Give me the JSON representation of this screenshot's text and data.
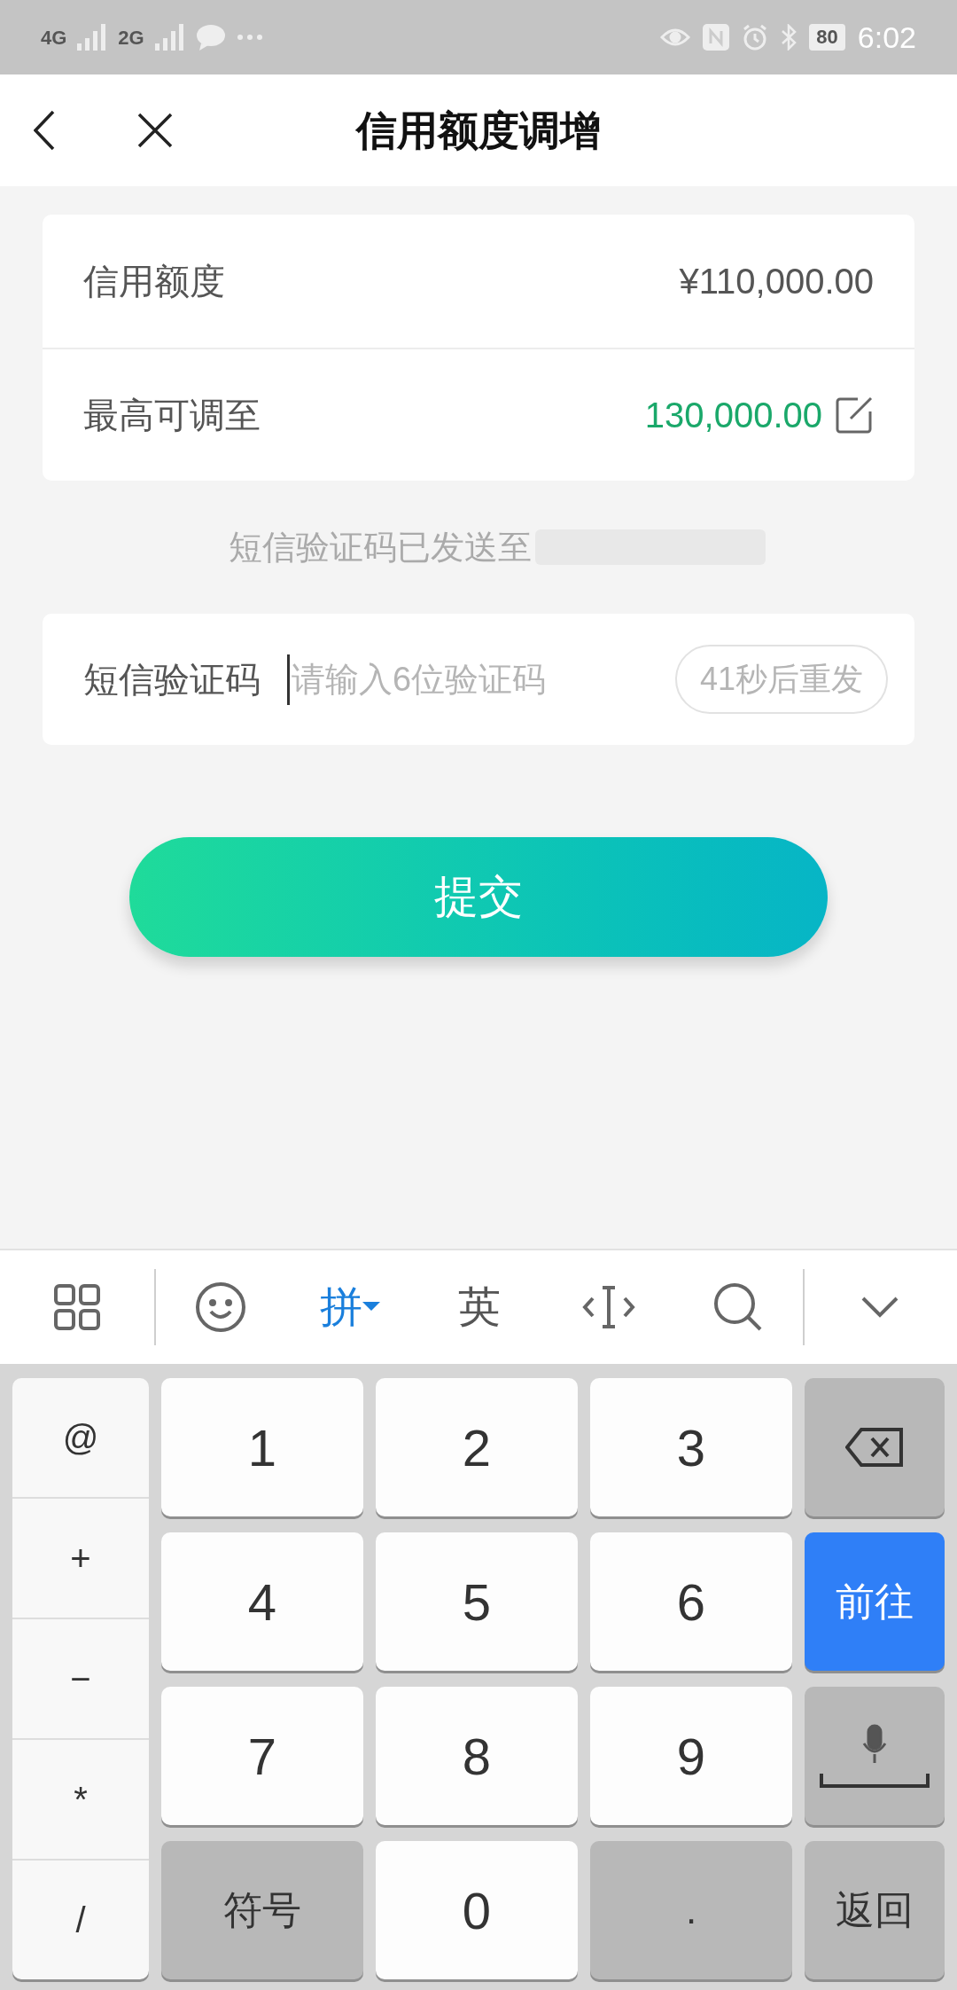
{
  "status_bar": {
    "network_1": "4G",
    "network_2": "2G",
    "battery": "80",
    "time": "6:02"
  },
  "header": {
    "title": "信用额度调增"
  },
  "credit_card": {
    "rows": [
      {
        "label": "信用额度",
        "value": "¥110,000.00",
        "kind": "plain"
      },
      {
        "label": "最高可调至",
        "value": "130,000.00",
        "kind": "editable"
      }
    ]
  },
  "sms_notice": "短信验证码已发送至",
  "code_field": {
    "label": "短信验证码",
    "placeholder": "请输入6位验证码",
    "resend": "41秒后重发"
  },
  "submit_button": "提交",
  "keyboard": {
    "toolbar": [
      {
        "kind": "grid"
      },
      {
        "kind": "emoji"
      },
      {
        "kind": "text",
        "label": "拼",
        "selected": true
      },
      {
        "kind": "text",
        "label": "英",
        "selected": false
      },
      {
        "kind": "cursor"
      },
      {
        "kind": "search"
      },
      {
        "kind": "collapse"
      }
    ],
    "side_keys": [
      "@",
      "+",
      "−",
      "*",
      "/"
    ],
    "keys": [
      {
        "kind": "digit",
        "label": "1"
      },
      {
        "kind": "digit",
        "label": "2"
      },
      {
        "kind": "digit",
        "label": "3"
      },
      {
        "kind": "delete"
      },
      {
        "kind": "digit",
        "label": "4"
      },
      {
        "kind": "digit",
        "label": "5"
      },
      {
        "kind": "digit",
        "label": "6"
      },
      {
        "kind": "go",
        "label": "前往"
      },
      {
        "kind": "digit",
        "label": "7"
      },
      {
        "kind": "digit",
        "label": "8"
      },
      {
        "kind": "digit",
        "label": "9"
      },
      {
        "kind": "space"
      },
      {
        "kind": "special",
        "label": "符号"
      },
      {
        "kind": "digit",
        "label": "0"
      },
      {
        "kind": "special",
        "label": "."
      },
      {
        "kind": "special",
        "label": "返回"
      }
    ]
  }
}
